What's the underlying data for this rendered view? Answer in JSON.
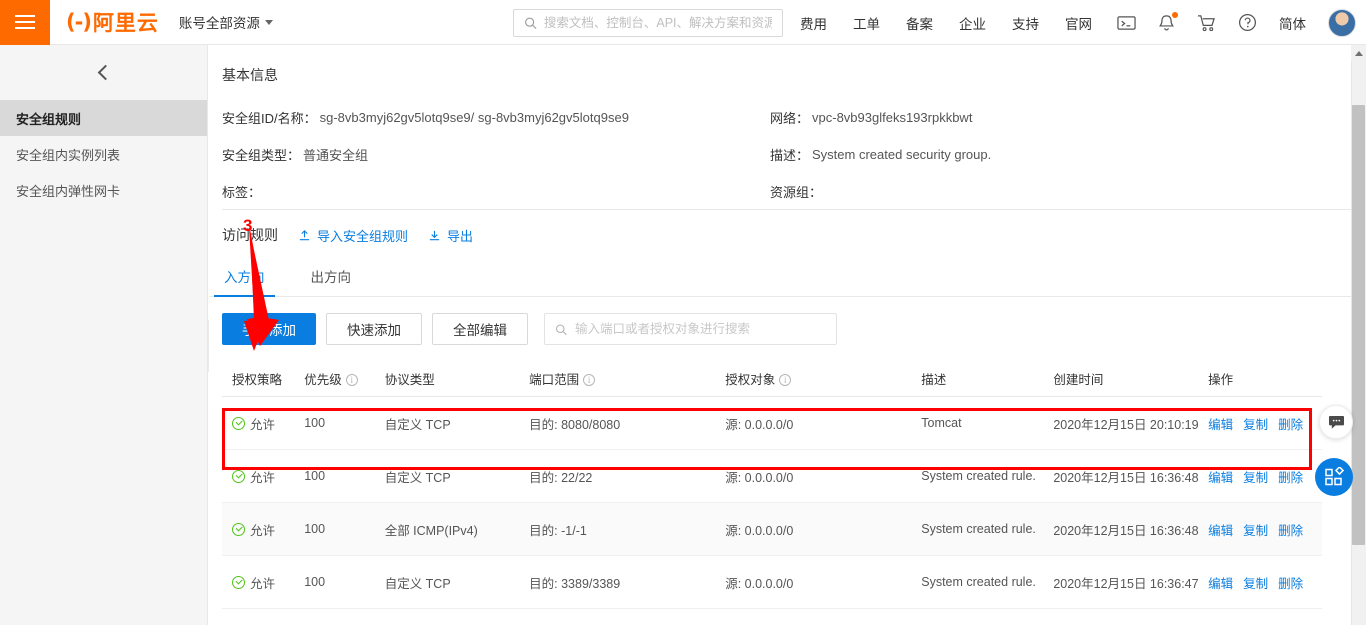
{
  "topbar": {
    "menu_icon": "hamburger-icon",
    "logo_mark": "(-)",
    "logo_text": "阿里云",
    "account_scope": "账号全部资源",
    "search_placeholder": "搜索文档、控制台、API、解决方案和资源",
    "search_value": "",
    "nav_links": [
      "费用",
      "工单",
      "备案",
      "企业",
      "支持",
      "官网"
    ],
    "icons": [
      "terminal-icon",
      "bell-icon",
      "cart-icon",
      "help-icon"
    ],
    "language": "简体",
    "avatar": "user-avatar"
  },
  "sidebar": {
    "collapse_icon": "chevron-left-icon",
    "items": [
      {
        "label": "安全组规则",
        "active": true
      },
      {
        "label": "安全组内实例列表",
        "active": false
      },
      {
        "label": "安全组内弹性网卡",
        "active": false
      }
    ]
  },
  "basic_info": {
    "title": "基本信息",
    "left_rows": [
      {
        "label": "安全组ID/名称：",
        "value": "sg-8vb3myj62gv5lotq9se9/ sg-8vb3myj62gv5lotq9se9"
      },
      {
        "label": "安全组类型：",
        "value": "普通安全组"
      },
      {
        "label": "标签：",
        "value": ""
      }
    ],
    "right_rows": [
      {
        "label": "网络：",
        "value": "vpc-8vb93glfeks193rpkkbwt"
      },
      {
        "label": "描述：",
        "value": "System created security group."
      },
      {
        "label": "资源组：",
        "value": ""
      }
    ]
  },
  "rules": {
    "title": "访问规则",
    "import_label": "导入安全组规则",
    "export_label": "导出",
    "tabs": [
      {
        "label": "入方向",
        "active": true
      },
      {
        "label": "出方向",
        "active": false
      }
    ],
    "toolbar": {
      "manual_add": "手动添加",
      "quick_add": "快速添加",
      "edit_all": "全部编辑",
      "search_placeholder": "输入端口或者授权对象进行搜索",
      "search_value": ""
    },
    "columns": [
      "授权策略",
      "优先级",
      "协议类型",
      "端口范围",
      "授权对象",
      "描述",
      "创建时间",
      "操作"
    ],
    "column_info_icons": [
      false,
      true,
      false,
      true,
      true,
      false,
      false,
      false
    ],
    "ops_labels": [
      "编辑",
      "复制",
      "删除"
    ],
    "rows": [
      {
        "policy": "允许",
        "priority": "100",
        "protocol": "自定义 TCP",
        "port": "目的: 8080/8080",
        "target": "源: 0.0.0.0/0",
        "desc": "Tomcat",
        "created": "2020年12月15日 20:10:19",
        "highlighted": true
      },
      {
        "policy": "允许",
        "priority": "100",
        "protocol": "自定义 TCP",
        "port": "目的: 22/22",
        "target": "源: 0.0.0.0/0",
        "desc": "System created rule.",
        "created": "2020年12月15日 16:36:48",
        "highlighted": false
      },
      {
        "policy": "允许",
        "priority": "100",
        "protocol": "全部 ICMP(IPv4)",
        "port": "目的: -1/-1",
        "target": "源: 0.0.0.0/0",
        "desc": "System created rule.",
        "created": "2020年12月15日 16:36:48",
        "highlighted": false
      },
      {
        "policy": "允许",
        "priority": "100",
        "protocol": "自定义 TCP",
        "port": "目的: 3389/3389",
        "target": "源: 0.0.0.0/0",
        "desc": "System created rule.",
        "created": "2020年12月15日 16:36:47",
        "highlighted": false
      }
    ]
  },
  "annotations": {
    "step_number": "3",
    "arrow_color": "#ff0000",
    "box_color": "#ff0000"
  },
  "float_widgets": {
    "chat": "chat-bubble-icon",
    "grid": "apps-grid-icon"
  },
  "colors": {
    "brand_orange": "#ff6a00",
    "link_blue": "#0a7ee0",
    "allow_green": "#52c41a"
  }
}
